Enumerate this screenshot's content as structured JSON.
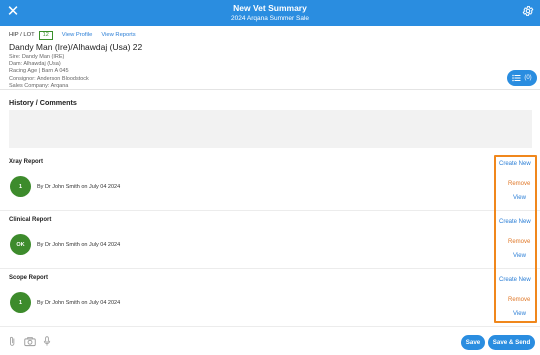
{
  "header": {
    "title": "New Vet Summary",
    "subtitle": "2024 Arqana Summer Sale",
    "close_icon": "close-icon",
    "settings_icon": "gear-icon",
    "bg_color": "#2a8de0"
  },
  "horse": {
    "hip_label": "HIP / LOT",
    "hip_number": "12",
    "view_profile": "View Profile",
    "view_reports": "View Reports",
    "name": "Dandy Man (Ire)/Alhawdaj (Usa) 22",
    "sire": "Sire: Dandy Man (IRE)",
    "dam": "Dam: Alhawdaj (Usa)",
    "racing_age": "Racing Age | Barn A 045",
    "consignor": "Consignor: Anderson Bloodstock",
    "sales_company": "Sales Company: Arqana"
  },
  "filter": {
    "count": "(0)",
    "icon": "list-filter-icon"
  },
  "history": {
    "title": "History / Comments",
    "value": ""
  },
  "reports": [
    {
      "name": "Xray Report",
      "badge": "1",
      "by": "By Dr John Smith on July 04 2024"
    },
    {
      "name": "Clinical Report",
      "badge": "OK",
      "by": "By Dr John Smith on July 04 2024"
    },
    {
      "name": "Scope Report",
      "badge": "1",
      "by": "By Dr John Smith on July 04 2024"
    }
  ],
  "actions": {
    "create_new": "Create New",
    "remove": "Remove",
    "view": "View"
  },
  "bottom": {
    "save": "Save",
    "save_send": "Save & Send",
    "icons": [
      "paperclip-icon",
      "camera-icon",
      "microphone-icon"
    ]
  },
  "colors": {
    "accent": "#2a8de0",
    "badge_green": "#3d8b2c",
    "remove_orange": "#e0792a",
    "highlight_orange": "#f0871c"
  }
}
